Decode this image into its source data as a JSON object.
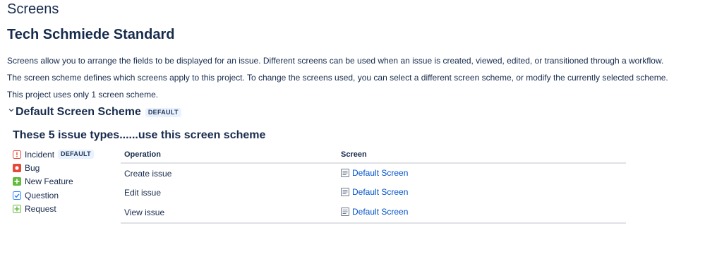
{
  "page": {
    "heading": "Screens",
    "project_title": "Tech Schmiede Standard",
    "paragraphs": [
      "Screens allow you to arrange the fields to be displayed for an issue. Different screens can be used when an issue is created, viewed, edited, or transitioned through a workflow.",
      "The screen scheme defines which screens apply to this project. To change the screens used, you can select a different screen scheme, or modify the currently selected scheme.",
      "This project uses only 1 screen scheme."
    ]
  },
  "scheme": {
    "name": "Default Screen Scheme",
    "badge": "DEFAULT",
    "expand_icon": "chevron-down-icon",
    "issue_types_heading": "These 5 issue types......use this screen scheme",
    "issue_types": [
      {
        "label": "Incident",
        "icon": "incident-icon",
        "color": "#e5493a",
        "badge": "DEFAULT"
      },
      {
        "label": "Bug",
        "icon": "bug-icon",
        "color": "#e5493a",
        "badge": ""
      },
      {
        "label": "New Feature",
        "icon": "new-feature-icon",
        "color": "#63ba3c",
        "badge": ""
      },
      {
        "label": "Question",
        "icon": "question-icon",
        "color": "#4bade8",
        "badge": ""
      },
      {
        "label": "Request",
        "icon": "request-icon",
        "color": "#63ba3c",
        "badge": ""
      }
    ],
    "table": {
      "headers": {
        "operation": "Operation",
        "screen": "Screen"
      },
      "rows": [
        {
          "operation": "Create issue",
          "screen": "Default Screen"
        },
        {
          "operation": "Edit issue",
          "screen": "Default Screen"
        },
        {
          "operation": "View issue",
          "screen": "Default Screen"
        }
      ]
    }
  },
  "colors": {
    "link": "#0052cc",
    "text": "#172b4d"
  }
}
